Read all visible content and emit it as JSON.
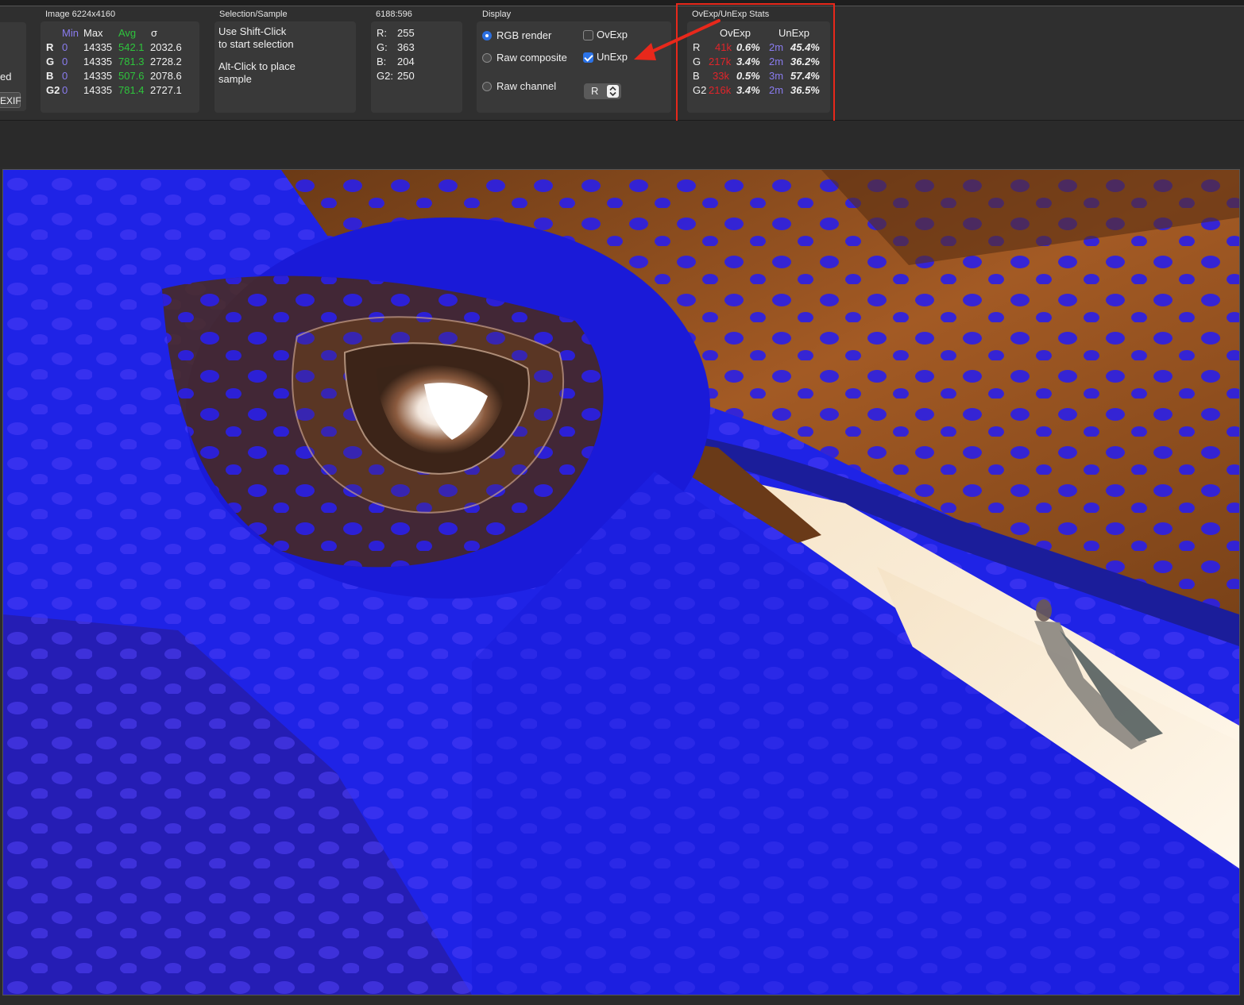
{
  "groups": {
    "image": {
      "title": "Image 6224x4160",
      "headers": {
        "min": "Min",
        "max": "Max",
        "avg": "Avg",
        "sigma": "σ"
      },
      "rows": [
        {
          "ch": "R",
          "min": "0",
          "max": "14335",
          "avg": "542.1",
          "sigma": "2032.6"
        },
        {
          "ch": "G",
          "min": "0",
          "max": "14335",
          "avg": "781.3",
          "sigma": "2728.2"
        },
        {
          "ch": "B",
          "min": "0",
          "max": "14335",
          "avg": "507.6",
          "sigma": "2078.6"
        },
        {
          "ch": "G2",
          "min": "0",
          "max": "14335",
          "avg": "781.4",
          "sigma": "2727.1"
        }
      ]
    },
    "left_partial": {
      "text": "ed",
      "exif_button": "EXIF"
    },
    "selection": {
      "title": "Selection/Sample",
      "line1": "Use Shift-Click",
      "line2": "to start selection",
      "line3": "Alt-Click to place",
      "line4": "sample"
    },
    "sample": {
      "title": "6188:596",
      "rows": [
        {
          "label": "R:",
          "value": "255"
        },
        {
          "label": "G:",
          "value": "363"
        },
        {
          "label": "B:",
          "value": "204"
        },
        {
          "label": "G2:",
          "value": "250"
        }
      ]
    },
    "display": {
      "title": "Display",
      "radios": [
        {
          "label": "RGB render",
          "checked": true
        },
        {
          "label": "Raw composite",
          "checked": false
        },
        {
          "label": "Raw channel",
          "checked": false
        }
      ],
      "checkboxes": [
        {
          "label": "OvExp",
          "checked": false
        },
        {
          "label": "UnExp",
          "checked": true
        }
      ],
      "channel_select": "R"
    },
    "stats": {
      "title": "OvExp/UnExp Stats",
      "col_ovexp": "OvExp",
      "col_unexp": "UnExp",
      "rows": [
        {
          "ch": "R",
          "ov_count": "41k",
          "ov_pct": "0.6%",
          "un_count": "2m",
          "un_pct": "45.4%"
        },
        {
          "ch": "G",
          "ov_count": "217k",
          "ov_pct": "3.4%",
          "un_count": "2m",
          "un_pct": "36.2%"
        },
        {
          "ch": "B",
          "ov_count": "33k",
          "ov_pct": "0.5%",
          "un_count": "3m",
          "un_pct": "57.4%"
        },
        {
          "ch": "G2",
          "ov_count": "216k",
          "ov_pct": "3.4%",
          "un_count": "2m",
          "un_pct": "36.5%"
        }
      ]
    }
  },
  "colors": {
    "underexposed_overlay": "#1f23e6",
    "highlight_box": "#e8281b",
    "accent": "#2b73e8"
  }
}
